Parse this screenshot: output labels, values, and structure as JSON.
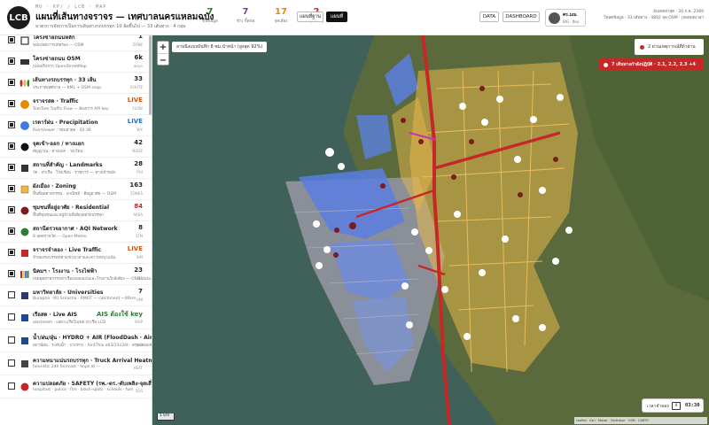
{
  "header": {
    "logo": "LCB",
    "breadcrumb": "MU · KP/ / LCB · MAP",
    "title": "แผนที่เส้นทางจราจร — เทศบาลนครแหลมฉบัง",
    "subtitle": "มาตรการจัดการเป็นการเดินทางรถบรรทุก 10 ล้อขึ้นไป — 33 เส้นทาง · 4 กลุ่ม",
    "stats": [
      {
        "value": "7",
        "label": "ชั้นข้อมูล",
        "color": "#2e7d32"
      },
      {
        "value": "7",
        "label": "ข้าง จิ๊ดขอ",
        "color": "#7b3fa0"
      },
      {
        "value": "17",
        "label": "จุดเสี่ยง",
        "color": "#e68a00"
      },
      {
        "value": "2",
        "label": "อุบัติเหตุ",
        "color": "#c62828"
      }
    ],
    "btn_basemap": "แผนที่ฐาน",
    "btn_map": "แผนที่",
    "btn_data": "DATA",
    "btn_dashboard": "DASHBOARD",
    "user_name": "ศร.มณ",
    "user_role": "BIG · สีดอ",
    "date_line": "อัปเดตล่าสุด · 20 ก.ค. 2569",
    "meta_line": "โหลดข้อมูล · 33 เส้นทาง · 4892 จุด OSM · เจลหมดเวลา"
  },
  "sidebar": {
    "layers": [
      {
        "name": "โครงข่ายถนนหลัก",
        "desc": "ขอบเขตการปกครอง — OSM",
        "count": "1",
        "unit": "ZONE",
        "checked": true,
        "icon": "boundary-icon",
        "count_color": "#222"
      },
      {
        "name": "โครงข่ายถนน OSM",
        "desc": "ถนนจริงจาก OpenStreetMap",
        "count": "6k",
        "unit": "ways",
        "checked": true,
        "icon": "road-network-icon",
        "count_color": "#222"
      },
      {
        "name": "เส้นทางรถบรรทุก · 33 เส้น",
        "desc": "ประกาศเทศบาล — KML + OSM snap",
        "count": "33",
        "unit": "ROUTE",
        "checked": true,
        "icon": "truck-route-icon",
        "count_color": "#222"
      },
      {
        "name": "จราจรสด · Traffic",
        "desc": "TomTom Traffic Flow — ต้องการ API key",
        "count": "LIVE",
        "unit": "FLOW",
        "checked": true,
        "icon": "traffic-icon",
        "count_color": "#e65100"
      },
      {
        "name": "เรดาร์ฝน · Precipitation",
        "desc": "RainViewer · รอบล่าสุด · 03:30",
        "count": "LIVE",
        "unit": "WX",
        "checked": true,
        "icon": "rain-radar-icon",
        "count_color": "#1e6fd9"
      },
      {
        "name": "จุดเข้า-ออก / ทางแยก",
        "desc": "สัญญาณ · ทางแยก · วงเวียน",
        "count": "42",
        "unit": "NODE",
        "checked": true,
        "icon": "junction-icon",
        "count_color": "#222"
      },
      {
        "name": "สถานที่สำคัญ · Landmarks",
        "desc": "วัด · ท่าเรือ · โรงเรียน · ราชการ — ทางเข้าหลัก",
        "count": "28",
        "unit": "POI",
        "checked": true,
        "icon": "landmark-icon",
        "count_color": "#222"
      },
      {
        "name": "ผังเมือง · Zoning",
        "desc": "พื้นที่อุตสาหกรรม · พาณิชย์ · ที่อยู่อาศัย — OSM",
        "count": "163",
        "unit": "ZONES",
        "checked": true,
        "icon": "zoning-icon",
        "count_color": "#222"
      },
      {
        "name": "ชุมชนที่อยู่อาศัย · Residential",
        "desc": "พื้นที่ชุมชนและหมู่บ้านที่เสี่ยงต่อรถบรรทุก",
        "count": "84",
        "unit": "AREA",
        "checked": true,
        "icon": "residential-icon",
        "count_color": "#c62828"
      },
      {
        "name": "สถานีตรวจอากาศ · AQI Network",
        "desc": "8 จุดตรวจวัด — Open-Meteo",
        "count": "8",
        "unit": "STN",
        "checked": true,
        "icon": "aqi-icon",
        "count_color": "#222"
      },
      {
        "name": "จราจรจำลอง · Live Traffic",
        "desc": "จำลองรถบรรทุกตามช่วงเวลาและความหนาแน่น",
        "count": "LIVE",
        "unit": "SIM",
        "checked": true,
        "icon": "truck-sim-icon",
        "count_color": "#e65100"
      },
      {
        "name": "นิคมฯ · โรงงาน · โรงไฟฟ้า",
        "desc": "เขตอุตสาหกรรมท่าเรือแหลมฉบังและโรงงานใกล้เคียง — OSM/data.go.th",
        "count": "23",
        "unit": "SITE",
        "checked": true,
        "icon": "industry-icon",
        "count_color": "#222"
      },
      {
        "name": "มหาวิทยาลัย · Universities",
        "desc": "Burapha · KU Sriracha · RMUT — catchment ~40km",
        "count": "7",
        "unit": "UNI",
        "checked": false,
        "icon": "university-icon",
        "count_color": "#222"
      },
      {
        "name": "เรือสด · Live AIS",
        "desc": "aisstream · เฉพาะเรือในเขต ท่าเรือ LCB",
        "count": "AIS ต้องใช้ key",
        "unit": "SHIP",
        "checked": false,
        "icon": "ship-icon",
        "count_color": "#2e7d32"
      },
      {
        "name": "น้ำ/ฝน/ฝุ่น · HYDRO + AIR (FloodDash · AirDash)",
        "desc": "สถานีฝน · ระดับน้ำ · ปากทาง · Air4Thai o63/33i/34t · ครอบคลุมจังหวัด",
        "count": "",
        "unit": "H₂O",
        "checked": false,
        "icon": "hydro-icon",
        "count_color": "#222"
      },
      {
        "name": "ความหนาแน่นรถบรรทุก · Truck Arrival Heatmap",
        "desc": "heuristic 24h forecast · hops at —",
        "count": "",
        "unit": "HEAT",
        "checked": false,
        "icon": "heatmap-icon",
        "count_color": "#222"
      },
      {
        "name": "ความปลอดภัย · SAFETY (รพ.-ตร.-ดับเพลิง-จุดเสี่ยง-โรงเรียน-ปั๊ม)",
        "desc": "hospitals · police · fire · black-spots · schools · fuel",
        "count": "",
        "unit": "SOS",
        "checked": false,
        "icon": "safety-icon",
        "count_color": "#222"
      }
    ]
  },
  "map": {
    "info_pill": "ลานนิ่งแบ่งบันทึก 8 ซม.นำหน้า (สูงสุด 92%)",
    "incidents_label": "2 ผ่านเหตุการณ์ที่ถ้าผ่าน",
    "routes_label": "7 เส้นทางกำลังปฏิบัติ · 2.1, 2.2, 2.3 +4",
    "scale_label": "1 km",
    "attribution": "Leaflet · Esri · Maxar · Earthstar · OSM · CARTO",
    "time_label": "เวลาจำลอง",
    "pause_label": "II",
    "time_value": "03:30"
  },
  "colors": {
    "route_red": "#c62828",
    "residential_yellow": "#e8b84a",
    "industrial_blue": "#5b7fe0",
    "sea": "#3e5c55"
  }
}
